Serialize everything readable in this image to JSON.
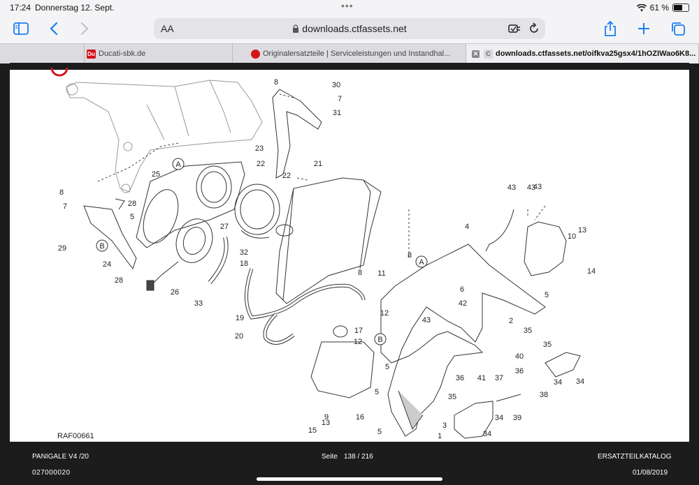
{
  "status": {
    "time": "17:24",
    "date": "Donnerstag 12. Sept.",
    "dots": "•••",
    "battery": "61 %",
    "battery_level": 0.61
  },
  "toolbar": {
    "text_size": "AA",
    "url": "downloads.ctfassets.net"
  },
  "tabs": [
    {
      "label": "Ducati-sbk.de",
      "favicon": "Du"
    },
    {
      "label": "Originalersatzteile | Serviceleistungen und Instandhal...",
      "favicon": ""
    },
    {
      "label": "downloads.ctfassets.net/oifkva25gsx4/1hOZIWao6K8...",
      "favicon": "C"
    }
  ],
  "diagram": {
    "ref": "RAF00661",
    "callouts": [
      "1",
      "2",
      "3",
      "4",
      "5",
      "5",
      "5",
      "5",
      "5",
      "6",
      "7",
      "7",
      "8",
      "8",
      "8",
      "8",
      "9",
      "10",
      "11",
      "12",
      "12",
      "13",
      "13",
      "14",
      "15",
      "16",
      "17",
      "18",
      "19",
      "20",
      "21",
      "22",
      "22",
      "23",
      "24",
      "25",
      "26",
      "27",
      "28",
      "28",
      "29",
      "30",
      "31",
      "32",
      "33",
      "34",
      "34",
      "34",
      "34",
      "35",
      "35",
      "35",
      "36",
      "36",
      "37",
      "38",
      "39",
      "40",
      "41",
      "42",
      "43",
      "43",
      "43",
      "43"
    ],
    "letters": [
      "A",
      "A",
      "B",
      "B"
    ]
  },
  "footer": {
    "model": "PANIGALE V4 /20",
    "code": "027000020",
    "page_label": "Seite",
    "page": "138 / 216",
    "catalog": "ERSATZTEILKATALOG",
    "date": "01/08/2019"
  },
  "colors": {
    "ducati_red": "#d2141b",
    "ios_blue": "#1a7ef5"
  }
}
